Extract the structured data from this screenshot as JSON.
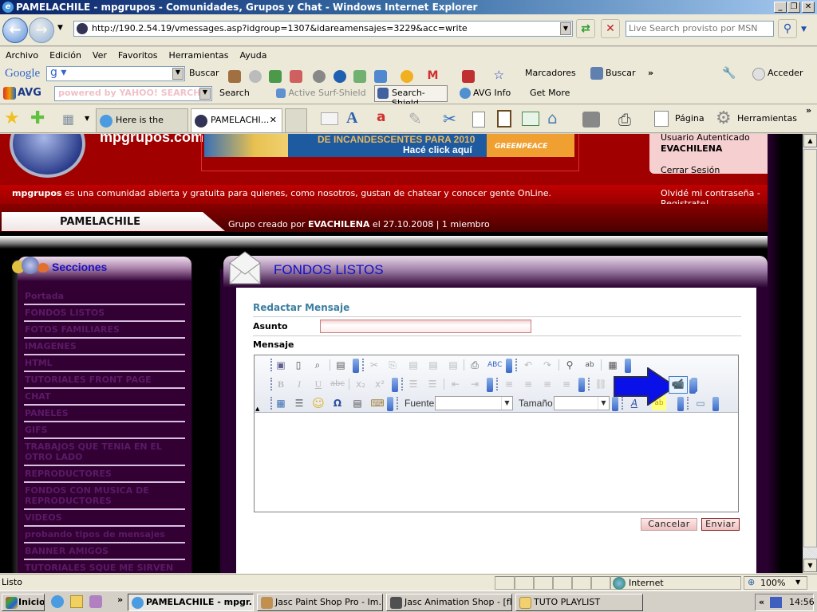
{
  "window": {
    "title": "PAMELACHILE - mpgrupos - Comunidades, Grupos y Chat - Windows Internet Explorer",
    "controls": [
      "_",
      "❐",
      "✕"
    ]
  },
  "addressbar": {
    "url": "http://190.2.54.19/vmessages.asp?idgroup=1307&idareamensajes=3229&acc=write",
    "search_placeholder": "Live Search provisto por MSN"
  },
  "menu": [
    "Archivo",
    "Edición",
    "Ver",
    "Favoritos",
    "Herramientas",
    "Ayuda"
  ],
  "google_toolbar": {
    "logo": "Google",
    "search_button": "Buscar",
    "bookmarks": "Marcadores",
    "find": "Buscar",
    "more": "»",
    "signin": "Acceder"
  },
  "avg_toolbar": {
    "logo": "AVG",
    "search_placeholder": "powered by YAHOO! SEARCH",
    "search_label": "Search",
    "active_surf_shield": "Active  Surf-Shield",
    "search_shield": "Search-Shield",
    "avg_info": "AVG Info",
    "get_more": "Get More"
  },
  "tabs": [
    {
      "label": "Here is the code...",
      "active": false
    },
    {
      "label": "PAMELACHI...",
      "active": true,
      "close": "✕"
    }
  ],
  "command_bar": {
    "page": "Página",
    "tools": "Herramientas",
    "more": "»"
  },
  "site": {
    "logo_text": "mpgrupos.com",
    "banner": {
      "line1": "DE INCANDESCENTES PARA 2010",
      "line2": "Hacé click aquí",
      "sponsor": "GREENPEACE"
    },
    "user": {
      "status": "Usuario Autenticado",
      "name": "EVACHILENA",
      "logout": "Cerrar Sesión"
    },
    "tagline_brand": "mpgrupos",
    "tagline": " es una comunidad abierta y gratuita para quienes, como nosotros, gustan de chatear y conocer gente OnLine.",
    "forgot": "Olvidé mi contraseña - Registrate!",
    "group": {
      "name": "PAMELACHILE",
      "created_prefix": "Grupo creado por ",
      "creator": "EVACHILENA",
      "created_suffix": " el 27.10.2008 | 1 miembro"
    }
  },
  "sidebar": {
    "title": "Secciones",
    "items": [
      "Portada",
      "FONDOS LISTOS",
      "FOTOS FAMILIARES",
      "IMAGENES",
      "HTML",
      "TUTORIALES FRONT PAGE",
      "CHAT",
      "PANELES",
      "GIFS",
      "TRABAJOS QUE TENIA EN EL OTRO LADO",
      "REPRODUCTORES",
      "FONDOS CON MUSICA DE REPRODUCTORES",
      "VIDEOS",
      "probando tipos de mensajes",
      "BANNER AMIGOS",
      "TUTORIALES SQUE ME SIRVEN PARA EL PAINT"
    ]
  },
  "main": {
    "section_title": "FONDOS LISTOS",
    "form_title": "Redactar Mensaje",
    "subject_label": "Asunto",
    "subject_value": "",
    "message_label": "Mensaje",
    "editor": {
      "font_label": "Fuente",
      "font_value": "",
      "size_label": "Tamaño",
      "size_value": "",
      "content": ""
    },
    "cancel": "Cancelar",
    "send": "Enviar"
  },
  "statusbar": {
    "status": "Listo",
    "zone": "Internet",
    "zoom": "100%"
  },
  "taskbar": {
    "start": "Inicio",
    "more": "»",
    "tasks": [
      {
        "label": "PAMELACHILE - mpgr...",
        "active": true
      },
      {
        "label": "Jasc Paint Shop Pro - Im...",
        "active": false
      },
      {
        "label": "Jasc Animation Shop - [fl...",
        "active": false
      },
      {
        "label": "TUTO PLAYLIST",
        "active": false
      }
    ],
    "tray_expand": "«",
    "clock": "14:56"
  },
  "colors": {
    "site_red": "#a00000",
    "sidebar_purple": "#330033",
    "title_blue": "#1010c8",
    "form_title": "#3b7ea0"
  }
}
